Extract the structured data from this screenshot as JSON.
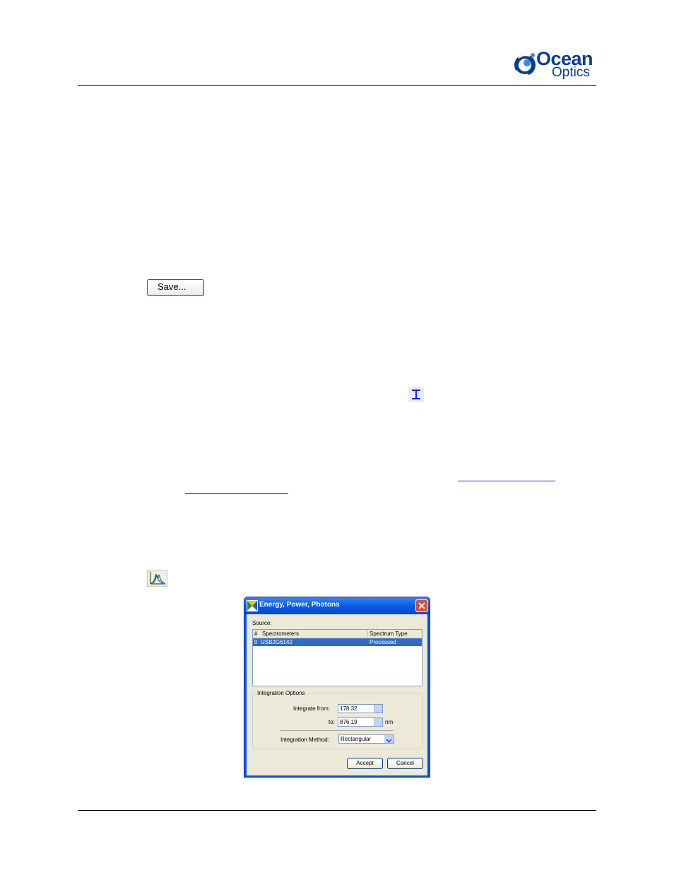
{
  "header": {
    "logo": {
      "word1": "Ocean",
      "word2": "Optics",
      "brand_color": "#0a3d91",
      "icon": "ocean-optics-swirl-logo"
    }
  },
  "body": {
    "save_button_label": "Save...",
    "integration_icon": "integration-marker-icon",
    "peak_icon": "spectrum-peak-icon"
  },
  "dialog": {
    "title": "Energy, Power, Photons",
    "source_label": "Source:",
    "columns": {
      "num": "#",
      "spectrometers": "Spectrometers",
      "type": "Spectrum Type"
    },
    "rows": [
      {
        "num": "0",
        "spectrometer": "USB2G6142",
        "type": "Processed"
      }
    ],
    "integration_group_label": "Integration Options",
    "integrate_from_label": "Integrate from:",
    "integrate_from_value": "178.32",
    "to_label": "to:",
    "to_value": "876.19",
    "unit": "nm",
    "method_label": "Integration Method:",
    "method_value": "Rectangular",
    "accept_label": "Accept",
    "cancel_label": "Cancel",
    "colors": {
      "titlebar": "#0a5ae6",
      "selection": "#316ac5",
      "close": "#e04a2c",
      "face": "#ece9d8"
    }
  }
}
